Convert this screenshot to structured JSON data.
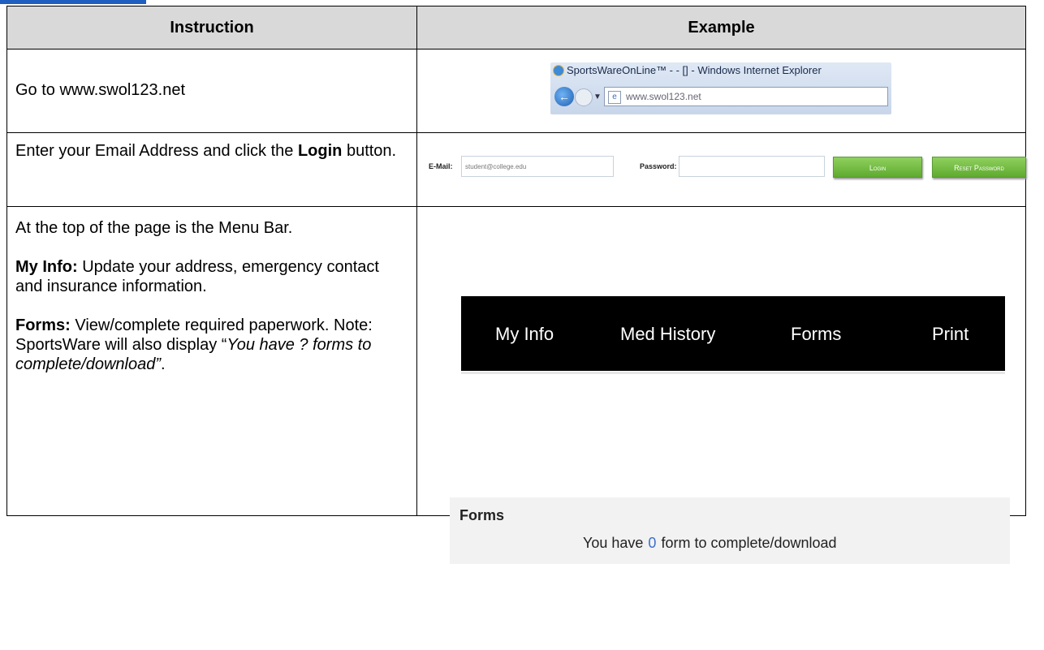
{
  "table": {
    "headers": [
      "Instruction",
      "Example"
    ]
  },
  "row1": {
    "instruction": "Go to www.swol123.net",
    "browser_title": "SportsWareOnLine™ - - [] - Windows Internet Explorer",
    "address_bar": "www.swol123.net"
  },
  "row2": {
    "instruction_prefix": "Enter your Email Address and click the ",
    "instruction_bold": "Login",
    "instruction_suffix": " button.",
    "email_label": "E-Mail:",
    "email_value": "student@college.edu",
    "password_label": "Password:",
    "login_button": "Login",
    "reset_button": "Reset Password"
  },
  "row3": {
    "intro": "At the top of the page is the Menu Bar.",
    "myinfo_label": "My Info:",
    "myinfo_text": " Update your address, emergency contact and insurance information.",
    "forms_label": "Forms:",
    "forms_text": " View/complete required paperwork. Note: SportsWare will also display “",
    "forms_italic": "You have ? forms to complete/download”",
    "forms_end": ".",
    "menu": [
      "My Info",
      "Med History",
      "Forms",
      "Print"
    ],
    "forms_panel_title": "Forms",
    "forms_msg_prefix": "You have",
    "forms_count": "0",
    "forms_msg_suffix": "form to complete/download"
  },
  "colors": {
    "menu_bg": "#000000",
    "button_green": "#6cbf3c",
    "count_blue": "#3b6fd0"
  }
}
